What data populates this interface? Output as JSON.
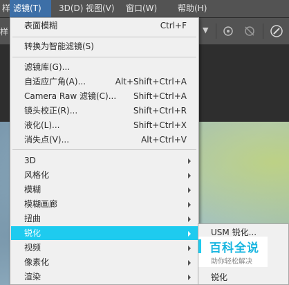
{
  "menubar": {
    "items": [
      {
        "label": "样"
      },
      {
        "label": "滤镜(T)",
        "active": true
      },
      {
        "label": "3D(D)"
      },
      {
        "label": "视图(V)"
      },
      {
        "label": "窗口(W)"
      },
      {
        "label": "帮助(H)"
      }
    ]
  },
  "options_bar": {
    "left_text": "样",
    "icons": [
      "chevron-down-icon",
      "brush-target-icon",
      "no-pressure-icon",
      "pressure-pen-icon"
    ]
  },
  "filter_menu": {
    "items": [
      {
        "label": "表面模糊",
        "shortcut": "Ctrl+F"
      },
      {
        "label": "转换为智能滤镜(S)",
        "shortcut": ""
      },
      {
        "label": "滤镜库(G)...",
        "shortcut": ""
      },
      {
        "label": "自适应广角(A)...",
        "shortcut": "Alt+Shift+Ctrl+A"
      },
      {
        "label": "Camera Raw 滤镜(C)...",
        "shortcut": "Shift+Ctrl+A"
      },
      {
        "label": "镜头校正(R)...",
        "shortcut": "Shift+Ctrl+R"
      },
      {
        "label": "液化(L)...",
        "shortcut": "Shift+Ctrl+X"
      },
      {
        "label": "消失点(V)...",
        "shortcut": "Alt+Ctrl+V"
      },
      {
        "label": "3D",
        "submenu": true
      },
      {
        "label": "风格化",
        "submenu": true
      },
      {
        "label": "模糊",
        "submenu": true
      },
      {
        "label": "模糊画廊",
        "submenu": true
      },
      {
        "label": "扭曲",
        "submenu": true
      },
      {
        "label": "锐化",
        "submenu": true,
        "highlighted": true
      },
      {
        "label": "视频",
        "submenu": true
      },
      {
        "label": "像素化",
        "submenu": true
      },
      {
        "label": "渲染",
        "submenu": true
      }
    ]
  },
  "sharpen_submenu": {
    "items": [
      {
        "label": "USM 锐化..."
      },
      {
        "label": "锐化"
      }
    ]
  },
  "watermark": {
    "title": "百科全说",
    "subtitle": "助你轻松解决"
  },
  "colors": {
    "highlight": "#1ecbef",
    "menubar_active": "#3d6fa7"
  }
}
